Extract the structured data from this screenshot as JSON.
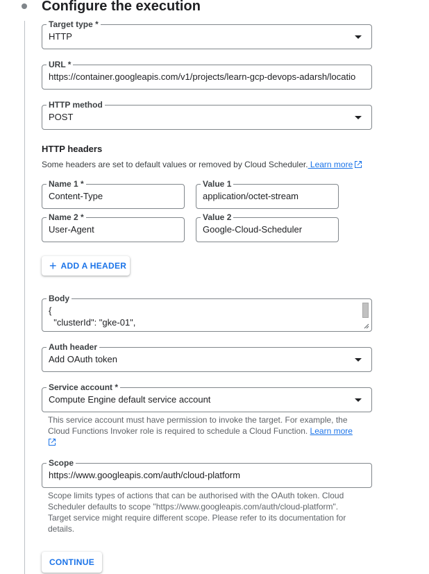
{
  "step": {
    "title": "Configure the execution"
  },
  "target_type": {
    "label": "Target type *",
    "value": "HTTP"
  },
  "url": {
    "label": "URL *",
    "value": "https://container.googleapis.com/v1/projects/learn-gcp-devops-adarsh/locatio"
  },
  "http_method": {
    "label": "HTTP method",
    "value": "POST"
  },
  "headers": {
    "heading": "HTTP headers",
    "helper": "Some headers are set to default values or removed by Cloud Scheduler.",
    "learn_more": " Learn more",
    "rows": [
      {
        "name_label": "Name 1 *",
        "name_value": "Content-Type",
        "value_label": "Value 1",
        "value_value": "application/octet-stream"
      },
      {
        "name_label": "Name 2 *",
        "name_value": "User-Agent",
        "value_label": "Value 2",
        "value_value": "Google-Cloud-Scheduler"
      }
    ],
    "add_label": "ADD A HEADER"
  },
  "body": {
    "label": "Body",
    "value": "{\n  \"clusterId\": \"gke-01\","
  },
  "auth_header": {
    "label": "Auth header",
    "value": "Add OAuth token"
  },
  "service_account": {
    "label": "Service account *",
    "value": "Compute Engine default service account",
    "helper": "This service account must have permission to invoke the target. For example, the Cloud Functions Invoker role is required to schedule a Cloud Function.",
    "learn_more": "Learn more"
  },
  "scope": {
    "label": "Scope",
    "value": "https://www.googleapis.com/auth/cloud-platform",
    "helper": "Scope limits types of actions that can be authorised with the OAuth token. Cloud Scheduler defaults to scope \"https://www.googleapis.com/auth/cloud-platform\". Target service might require different scope. Please refer to its documentation for details."
  },
  "continue_label": "CONTINUE",
  "colors": {
    "accent": "#1a73e8",
    "border": "#80868b",
    "helper_text": "#5f6368"
  }
}
